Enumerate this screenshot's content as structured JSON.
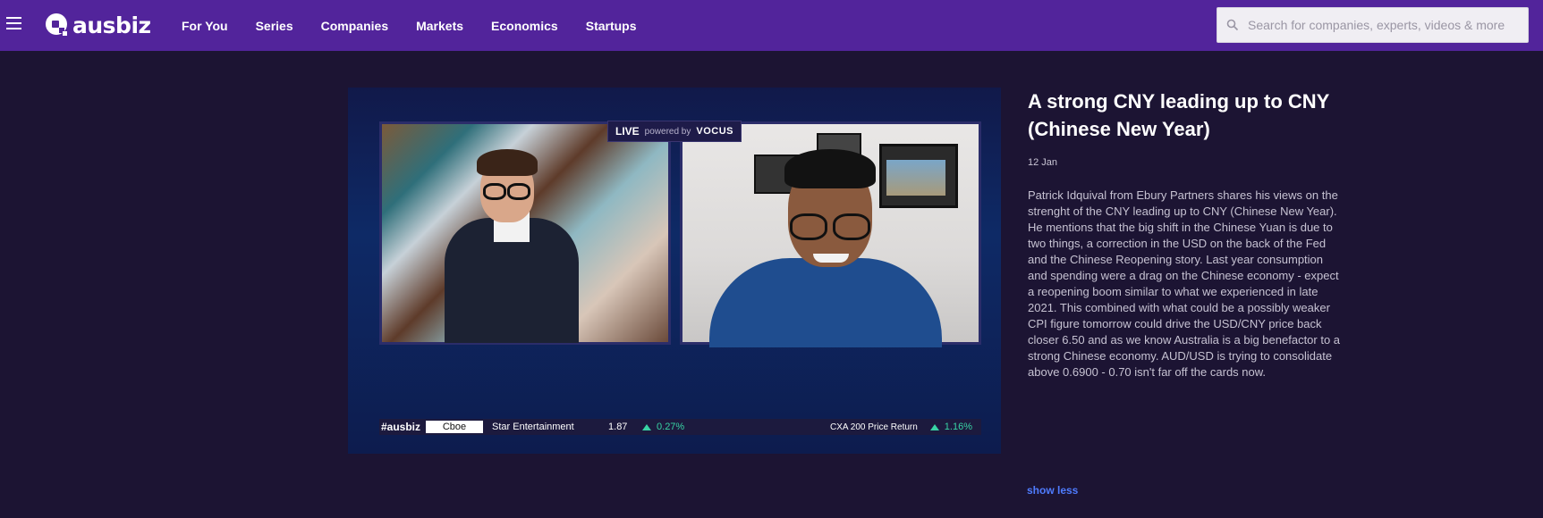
{
  "header": {
    "logo_text": "ausbiz",
    "nav": [
      {
        "label": "For You"
      },
      {
        "label": "Series"
      },
      {
        "label": "Companies"
      },
      {
        "label": "Markets"
      },
      {
        "label": "Economics"
      },
      {
        "label": "Startups"
      }
    ],
    "search_placeholder": "Search for companies, experts, videos & more"
  },
  "video": {
    "live_label": "LIVE",
    "powered_by": "powered by",
    "sponsor": "VOCUS",
    "ticker": {
      "brand": "#ausbiz",
      "exchange": "Cboe",
      "company": "Star Entertainment",
      "price": "1.87",
      "change": "0.27%",
      "index_name": "CXA 200 Price Return",
      "index_change": "1.16%"
    }
  },
  "article": {
    "title": "A strong CNY leading up to CNY (Chinese New Year)",
    "date": "12 Jan",
    "description": "Patrick Idquival from Ebury Partners shares his views on the strenght of the CNY leading up to CNY (Chinese New Year). He mentions that the big shift in the Chinese Yuan is due to two things,  a correction in the USD on the back of the Fed and the Chinese Reopening story. Last year consumption and spending were a drag on the Chinese economy - expect a reopening boom similar to what we experienced in late 2021. This combined with what could be a possibly weaker CPI figure tomorrow could drive the USD/CNY price back closer 6.50 and as we know Australia is a big benefactor to a strong Chinese economy. AUD/USD is trying to consolidate above 0.6900 - 0.70 isn't far off the cards now.",
    "toggle_label": "show less"
  },
  "colors": {
    "header_bg": "#52249b",
    "page_bg": "#1c1433",
    "link": "#4f7cff",
    "ticker_up": "#38d3a4"
  }
}
